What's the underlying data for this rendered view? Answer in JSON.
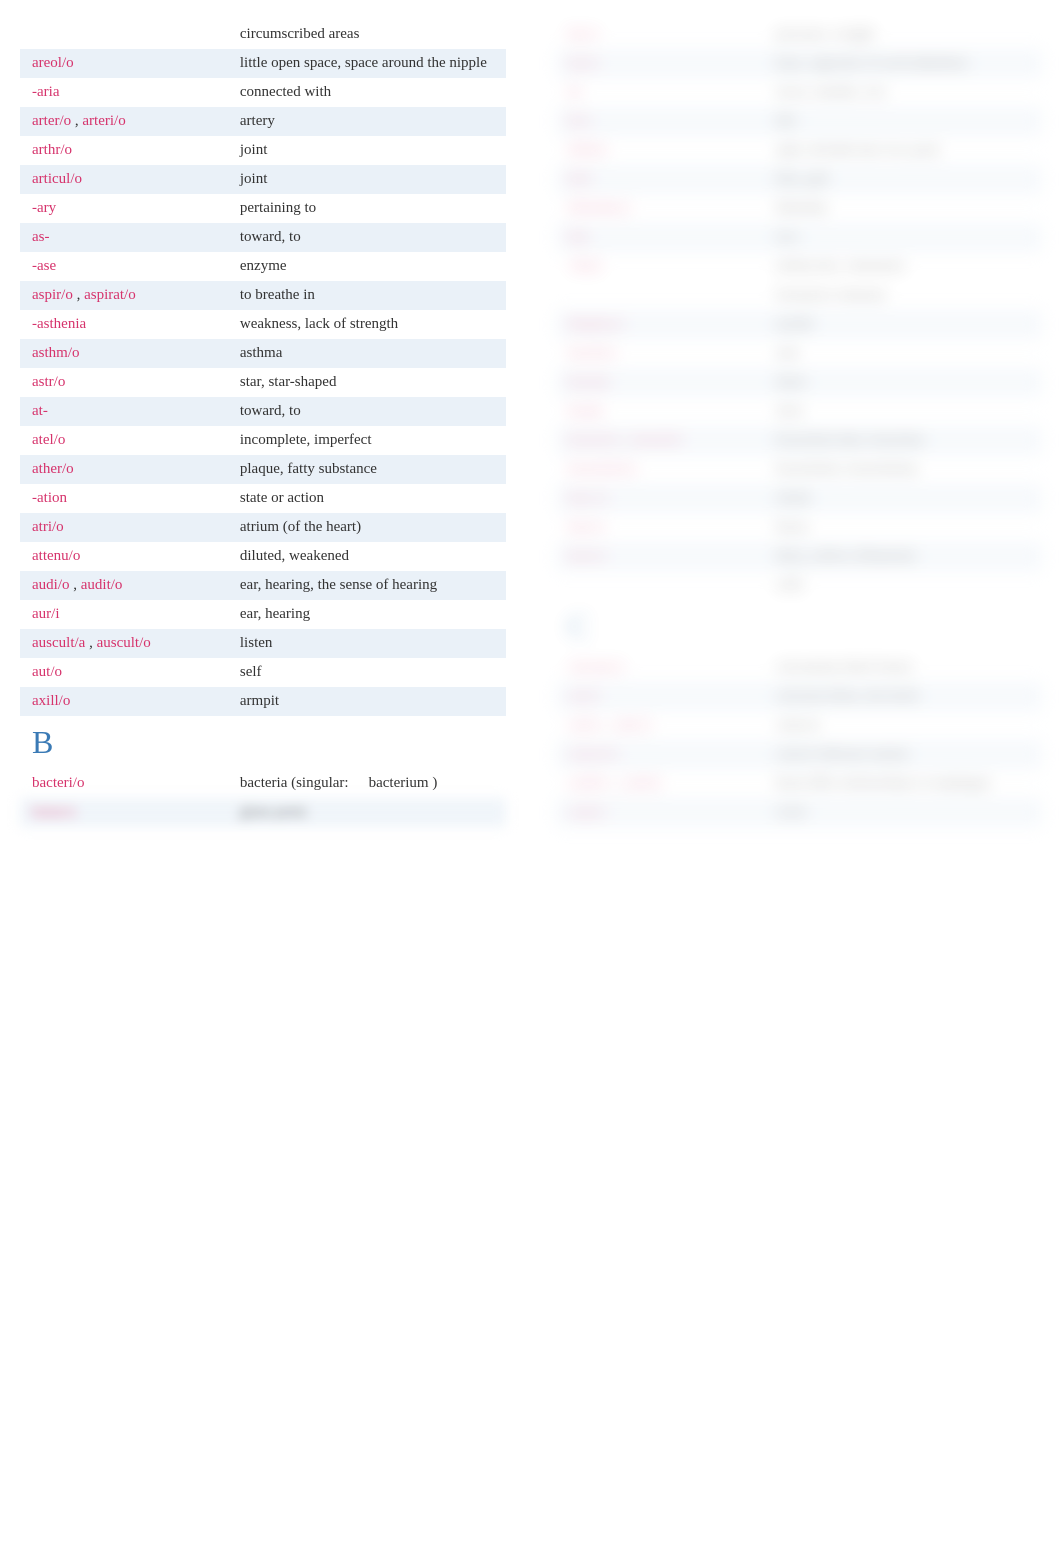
{
  "left_column": {
    "entries": [
      {
        "terms": [],
        "definition": "circumscribed areas",
        "shaded": false
      },
      {
        "terms": [
          "areol/o"
        ],
        "definition": "little open space, space around the nipple",
        "shaded": true
      },
      {
        "terms": [
          "-aria"
        ],
        "definition": "connected with",
        "shaded": false
      },
      {
        "terms": [
          "arter/o",
          "arteri/o"
        ],
        "definition": "artery",
        "shaded": true
      },
      {
        "terms": [
          "arthr/o"
        ],
        "definition": "joint",
        "shaded": false
      },
      {
        "terms": [
          "articul/o"
        ],
        "definition": "joint",
        "shaded": true
      },
      {
        "terms": [
          "-ary"
        ],
        "definition": "pertaining to",
        "shaded": false
      },
      {
        "terms": [
          "as-"
        ],
        "definition": "toward, to",
        "shaded": true
      },
      {
        "terms": [
          "-ase"
        ],
        "definition": "enzyme",
        "shaded": false
      },
      {
        "terms": [
          "aspir/o",
          "aspirat/o"
        ],
        "definition": "to breathe in",
        "shaded": true
      },
      {
        "terms": [
          "-asthenia"
        ],
        "definition": "weakness, lack of strength",
        "shaded": false
      },
      {
        "terms": [
          "asthm/o"
        ],
        "definition": "asthma",
        "shaded": true
      },
      {
        "terms": [
          "astr/o"
        ],
        "definition": "star, star-shaped",
        "shaded": false
      },
      {
        "terms": [
          "at-"
        ],
        "definition": "toward, to",
        "shaded": true
      },
      {
        "terms": [
          "atel/o"
        ],
        "definition": "incomplete, imperfect",
        "shaded": false
      },
      {
        "terms": [
          "ather/o"
        ],
        "definition": "plaque, fatty substance",
        "shaded": true
      },
      {
        "terms": [
          "-ation"
        ],
        "definition": "state or action",
        "shaded": false
      },
      {
        "terms": [
          "atri/o"
        ],
        "definition": "atrium (of the heart)",
        "shaded": true
      },
      {
        "terms": [
          "attenu/o"
        ],
        "definition": "diluted, weakened",
        "shaded": false
      },
      {
        "terms": [
          "audi/o",
          "audit/o"
        ],
        "definition": "ear, hearing, the sense of hearing",
        "shaded": true
      },
      {
        "terms": [
          "aur/i"
        ],
        "definition": "ear, hearing",
        "shaded": false
      },
      {
        "terms": [
          "auscult/a",
          "auscult/o"
        ],
        "definition": "listen",
        "shaded": true
      },
      {
        "terms": [
          "aut/o"
        ],
        "definition": "self",
        "shaded": false
      },
      {
        "terms": [
          "axill/o"
        ],
        "definition": "armpit",
        "shaded": true
      }
    ],
    "section_b": "B",
    "b_entries": [
      {
        "terms": [
          "bacteri/o"
        ],
        "definition": "bacteria (singular:",
        "def2": "bacterium",
        "shaded": false,
        "trailing": ")"
      },
      {
        "terms": [
          "balan/o"
        ],
        "definition": "glans penis",
        "shaded": true,
        "blurred": true
      }
    ]
  },
  "right_column": {
    "entries": [
      {
        "terms": [
          "bar/o"
        ],
        "definition": "pressure, weight",
        "shaded": false
      },
      {
        "terms": [
          "bas/o"
        ],
        "definition": "base, opposite of acid (alkaline)",
        "shaded": true
      },
      {
        "terms": [
          "bi-"
        ],
        "definition": "twice, double, two",
        "shaded": false
      },
      {
        "terms": [
          "bi/o"
        ],
        "definition": "life",
        "shaded": true
      },
      {
        "terms": [
          "bifid/o"
        ],
        "definition": "split, divided into two parts",
        "shaded": false
      },
      {
        "terms": [
          "bil/i"
        ],
        "definition": "bile, gall",
        "shaded": true
      },
      {
        "terms": [
          "bilirubin/o"
        ],
        "definition": "bilirubin",
        "shaded": false
      },
      {
        "terms": [
          "bin-"
        ],
        "definition": "two",
        "shaded": true
      },
      {
        "terms": [
          "-blast"
        ],
        "definition": "embryonic, immature",
        "shaded": false
      },
      {
        "terms": [],
        "definition": "formative element",
        "shaded": false,
        "continuation": true
      },
      {
        "terms": [
          "blephar/o"
        ],
        "definition": "eyelid",
        "shaded": true
      },
      {
        "terms": [
          "brachi/o"
        ],
        "definition": "arm",
        "shaded": false
      },
      {
        "terms": [
          "brachy-"
        ],
        "definition": "short",
        "shaded": true
      },
      {
        "terms": [
          "brady-"
        ],
        "definition": "slow",
        "shaded": false
      },
      {
        "terms": [
          "bronch/o",
          "bronch/i"
        ],
        "definition": "bronchial tube, bronchus",
        "shaded": true
      },
      {
        "terms": [
          "bronchiol/o"
        ],
        "definition": "bronchiole, bronchiolus",
        "shaded": false
      },
      {
        "terms": [
          "bucc/o"
        ],
        "definition": "cheek",
        "shaded": true
      },
      {
        "terms": [
          "burs/o"
        ],
        "definition": "bursa",
        "shaded": false
      },
      {
        "terms": [
          "byss/o"
        ],
        "definition": "dirty, yellow (filament)",
        "shaded": true
      },
      {
        "terms": [],
        "definition": "cells",
        "shaded": false,
        "continuation": true
      }
    ],
    "section_c": "C",
    "c_entries": [
      {
        "terms": [
          "calcane/o"
        ],
        "definition": "calcaneum (heel bone)",
        "shaded": false
      },
      {
        "terms": [
          "calc/i"
        ],
        "definition": "calcium (lime, the heel)",
        "shaded": true
      },
      {
        "terms": [
          "cali/o",
          "calic/o"
        ],
        "definition": "calyces",
        "shaded": false
      },
      {
        "terms": [
          "cancer/o"
        ],
        "definition": "cancer (disease name)",
        "shaded": true
      },
      {
        "terms": [
          "cardi/o",
          "cardi/a"
        ],
        "definition": "heart (Bls relationship to esophagus",
        "shaded": false
      },
      {
        "terms": [
          "carp/o"
        ],
        "definition": "wrist",
        "shaded": true
      }
    ]
  }
}
